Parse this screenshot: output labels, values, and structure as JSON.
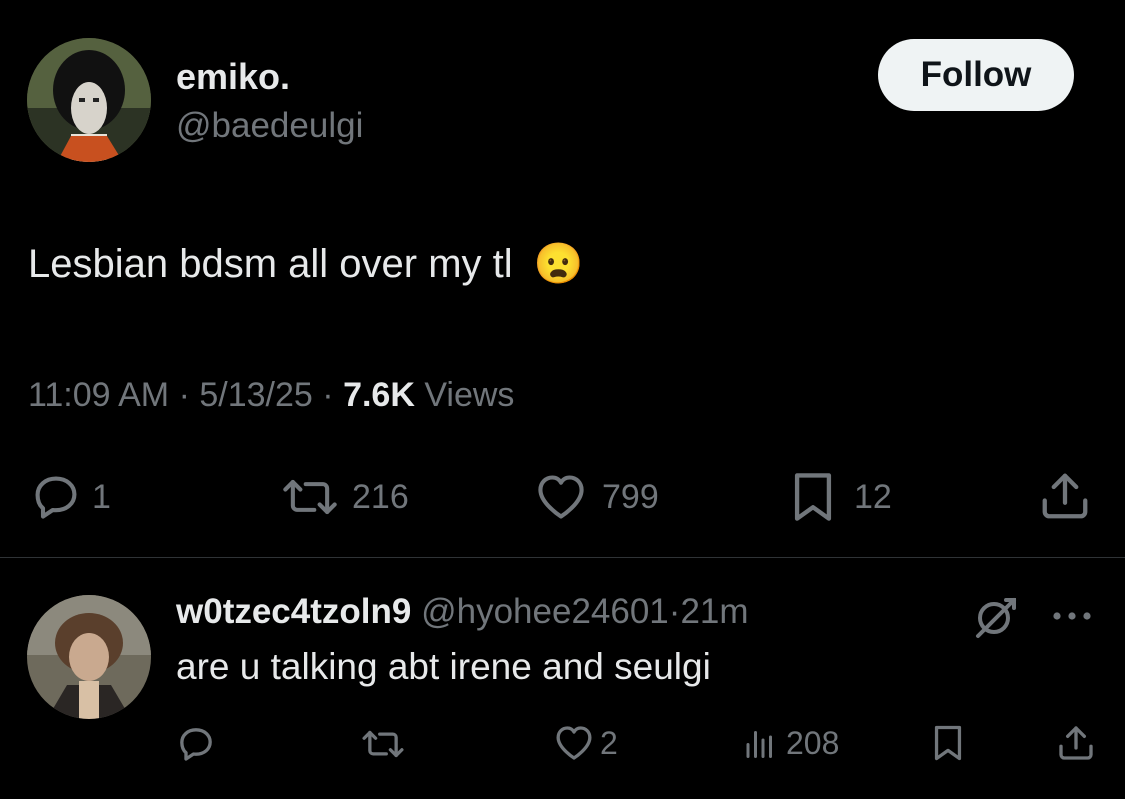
{
  "tweet": {
    "author_name": "emiko.",
    "author_handle": "@baedeulgi",
    "follow_label": "Follow",
    "text": "Lesbian bdsm all over my tl",
    "time": "11:09 AM",
    "sep1": "·",
    "date": "5/13/25",
    "sep2": "·",
    "views_count": "7.6K",
    "views_label": "Views",
    "replies": "1",
    "reposts": "216",
    "likes": "799",
    "bookmarks": "12",
    "emoji": "😦"
  },
  "reply": {
    "author_name": "w0tzec4tzoln9",
    "author_handle": "@hyohee24601",
    "sep": "·",
    "time": "21m",
    "text": "are u talking abt irene and seulgi",
    "likes": "2",
    "views": "208"
  },
  "colors": {
    "background": "#000000",
    "text": "#e7e9ea",
    "muted": "#71767b",
    "divider": "#2f3336",
    "follow_bg": "#eff3f4"
  }
}
